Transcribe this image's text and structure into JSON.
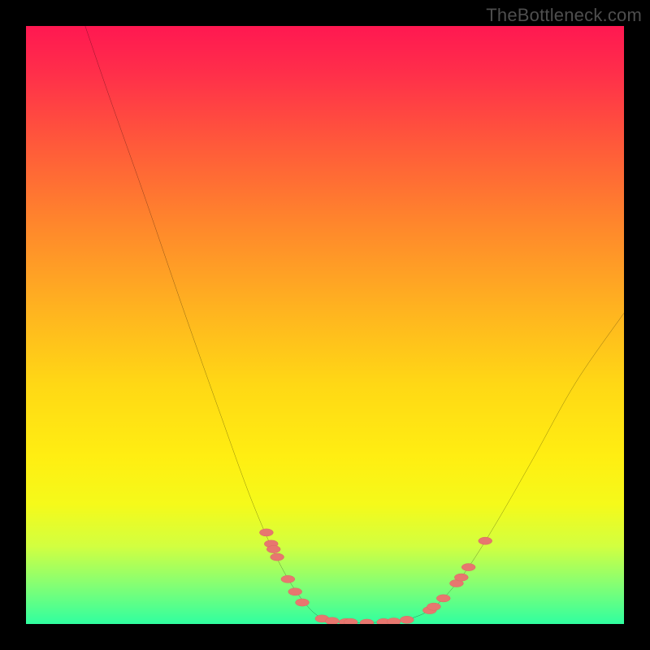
{
  "watermark": "TheBottleneck.com",
  "chart_data": {
    "type": "line",
    "title": "",
    "subtitle": "",
    "xlabel": "",
    "ylabel": "",
    "xlim": [
      0,
      100
    ],
    "ylim": [
      0,
      100
    ],
    "grid": false,
    "legend": false,
    "curve": [
      {
        "x": 9.9,
        "y": 100.0
      },
      {
        "x": 14.0,
        "y": 88.0
      },
      {
        "x": 20.0,
        "y": 71.0
      },
      {
        "x": 26.0,
        "y": 53.5
      },
      {
        "x": 32.0,
        "y": 36.5
      },
      {
        "x": 38.0,
        "y": 20.0
      },
      {
        "x": 43.0,
        "y": 9.0
      },
      {
        "x": 47.5,
        "y": 2.5
      },
      {
        "x": 51.0,
        "y": 0.5
      },
      {
        "x": 55.0,
        "y": 0.2
      },
      {
        "x": 59.0,
        "y": 0.3
      },
      {
        "x": 63.0,
        "y": 0.6
      },
      {
        "x": 67.0,
        "y": 2.0
      },
      {
        "x": 70.0,
        "y": 4.5
      },
      {
        "x": 74.0,
        "y": 9.5
      },
      {
        "x": 79.0,
        "y": 17.5
      },
      {
        "x": 85.0,
        "y": 28.0
      },
      {
        "x": 92.0,
        "y": 40.5
      },
      {
        "x": 100.0,
        "y": 52.0
      }
    ],
    "markers": [
      {
        "x": 40.2,
        "y": 15.3
      },
      {
        "x": 41.0,
        "y": 13.4
      },
      {
        "x": 41.4,
        "y": 12.5
      },
      {
        "x": 42.0,
        "y": 11.2
      },
      {
        "x": 43.8,
        "y": 7.5
      },
      {
        "x": 45.0,
        "y": 5.4
      },
      {
        "x": 46.2,
        "y": 3.6
      },
      {
        "x": 49.5,
        "y": 0.9
      },
      {
        "x": 51.2,
        "y": 0.5
      },
      {
        "x": 53.5,
        "y": 0.3
      },
      {
        "x": 54.3,
        "y": 0.3
      },
      {
        "x": 57.0,
        "y": 0.2
      },
      {
        "x": 59.8,
        "y": 0.3
      },
      {
        "x": 61.5,
        "y": 0.4
      },
      {
        "x": 63.7,
        "y": 0.7
      },
      {
        "x": 67.5,
        "y": 2.3
      },
      {
        "x": 68.2,
        "y": 2.9
      },
      {
        "x": 69.8,
        "y": 4.3
      },
      {
        "x": 72.0,
        "y": 6.8
      },
      {
        "x": 72.8,
        "y": 7.8
      },
      {
        "x": 74.0,
        "y": 9.5
      },
      {
        "x": 76.8,
        "y": 13.9
      }
    ],
    "gradient_stops": [
      {
        "pos": 0.0,
        "color": "#ff1851"
      },
      {
        "pos": 0.08,
        "color": "#ff2f4a"
      },
      {
        "pos": 0.2,
        "color": "#ff5a3a"
      },
      {
        "pos": 0.33,
        "color": "#ff862c"
      },
      {
        "pos": 0.47,
        "color": "#ffb220"
      },
      {
        "pos": 0.6,
        "color": "#ffd815"
      },
      {
        "pos": 0.72,
        "color": "#ffee12"
      },
      {
        "pos": 0.8,
        "color": "#f5fa1a"
      },
      {
        "pos": 0.87,
        "color": "#d2ff40"
      },
      {
        "pos": 0.93,
        "color": "#8aff70"
      },
      {
        "pos": 1.0,
        "color": "#30ffa0"
      }
    ]
  }
}
